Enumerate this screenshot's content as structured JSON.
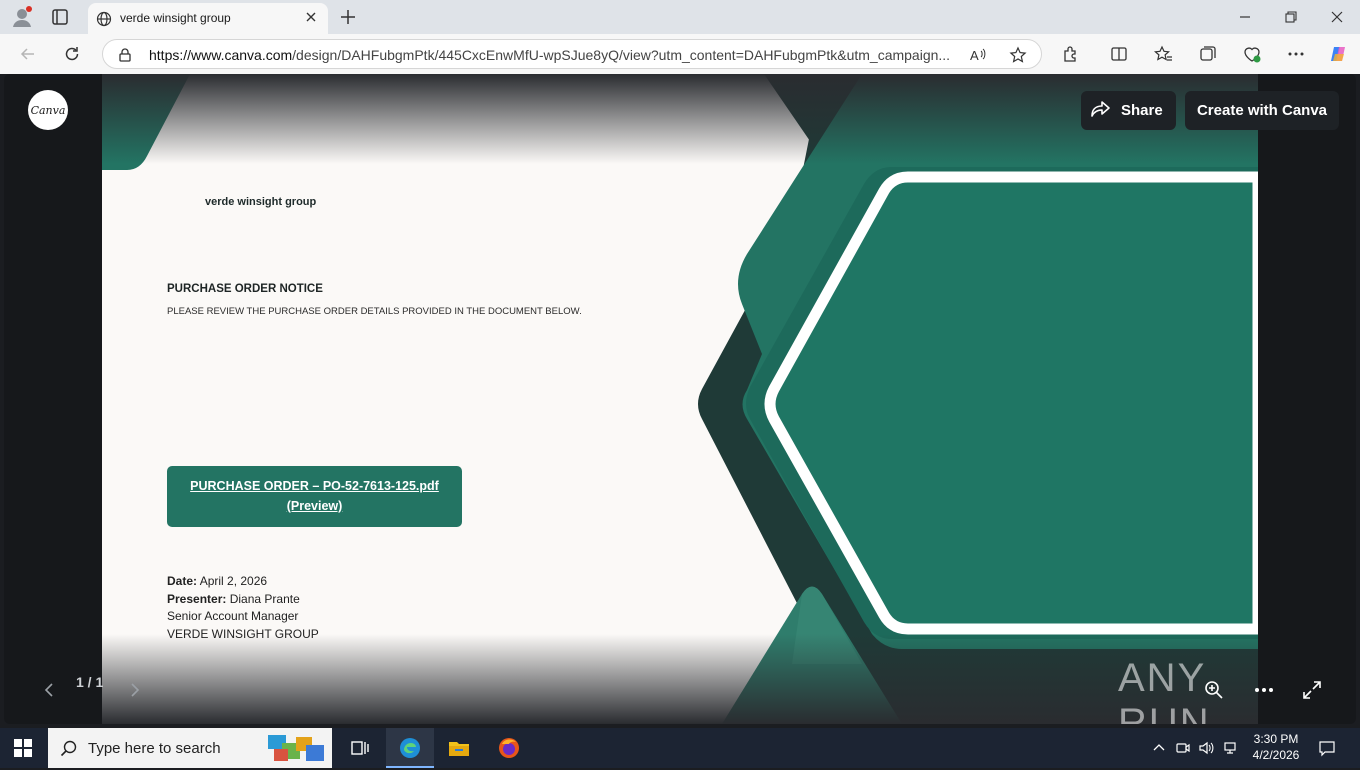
{
  "browser": {
    "tab_title": "verde winsight group",
    "url_host": "https://www.canva.com",
    "url_path": "/design/DAHFubgmPtk/445CxcEnwMfU-wpSJue8yQ/view?utm_content=DAHFubgmPtk&utm_campaign..."
  },
  "viewer": {
    "logo_text": "Canva",
    "share_label": "Share",
    "create_label": "Create with Canva",
    "page_counter": "1 / 1",
    "watermark": "ANY RUN"
  },
  "slide": {
    "company": "verde winsight group",
    "notice_title": "PURCHASE ORDER NOTICE",
    "notice_subtitle": "PLEASE REVIEW THE PURCHASE ORDER DETAILS PROVIDED IN THE DOCUMENT BELOW.",
    "po_link_line1": "PURCHASE ORDER – PO-52-7613-125.pdf",
    "po_link_line2": "(Preview)",
    "date_label": "Date:",
    "date_value": "April 2, 2026",
    "presenter_label": "Presenter:",
    "presenter_value": "Diana Prante",
    "role": "Senior Account Manager",
    "org": "VERDE WINSIGHT GROUP",
    "colors": {
      "teal": "#237463",
      "dark": "#1f3a37"
    }
  },
  "taskbar": {
    "search_placeholder": "Type here to search",
    "time": "3:30 PM",
    "date": "4/2/2026"
  }
}
